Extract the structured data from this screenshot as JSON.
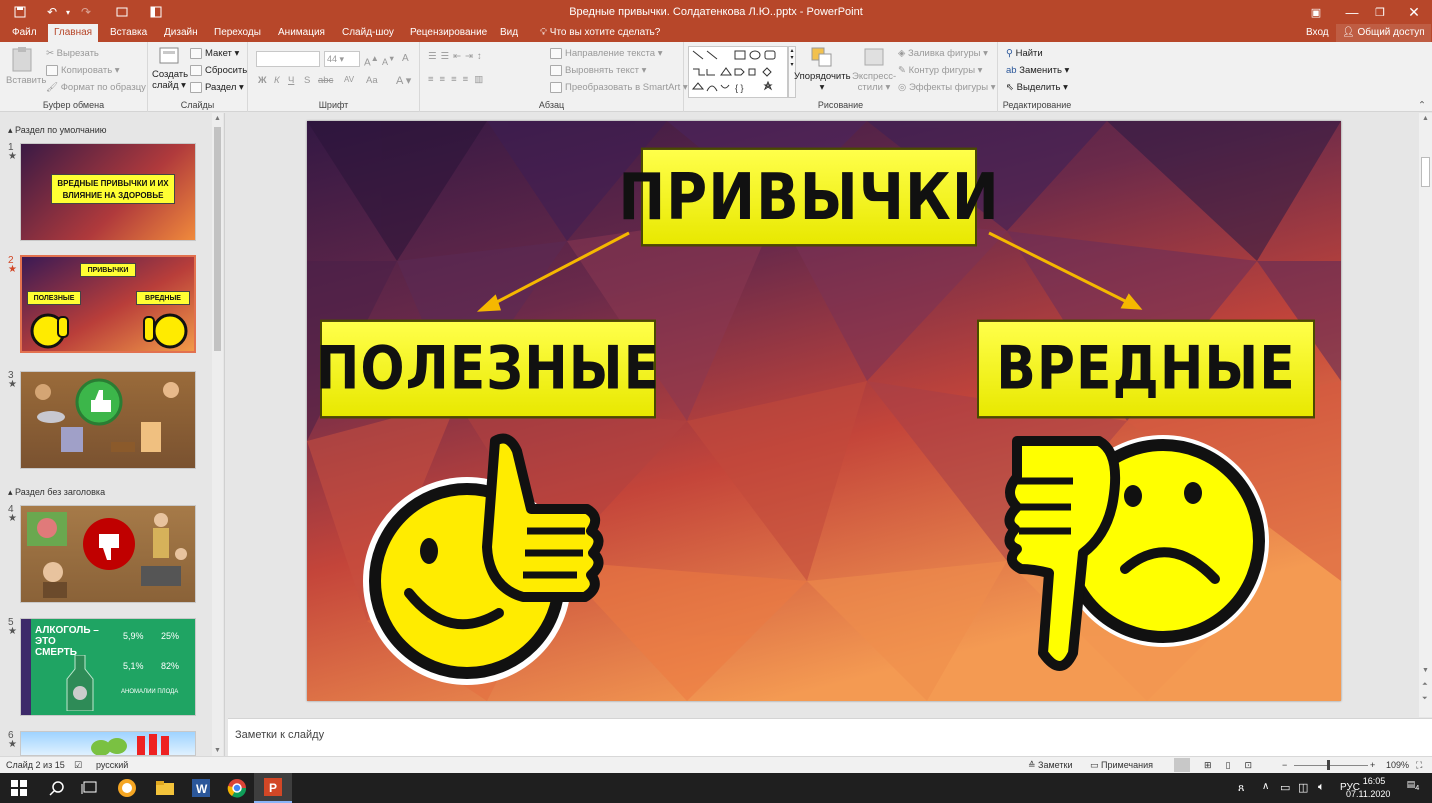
{
  "window": {
    "title": "Вредные привычки. Солдатенкова Л.Ю..pptx - PowerPoint",
    "enter_label": "Вход",
    "share_label": "Общий доступ"
  },
  "tabs": [
    {
      "label": "Файл"
    },
    {
      "label": "Главная"
    },
    {
      "label": "Вставка"
    },
    {
      "label": "Дизайн"
    },
    {
      "label": "Переходы"
    },
    {
      "label": "Анимация"
    },
    {
      "label": "Слайд-шоу"
    },
    {
      "label": "Рецензирование"
    },
    {
      "label": "Вид"
    }
  ],
  "tell_me": "Что вы хотите сделать?",
  "ribbon": {
    "clipboard": {
      "label": "Буфер обмена",
      "paste": "Вставить",
      "cut": "Вырезать",
      "copy": "Копировать",
      "format": "Формат по образцу"
    },
    "slides": {
      "label": "Слайды",
      "new_slide_1": "Создать",
      "new_slide_2": "слайд",
      "layout": "Макет",
      "reset": "Сбросить",
      "section": "Раздел"
    },
    "font": {
      "label": "Шрифт",
      "size": "44",
      "bold": "Ж",
      "italic": "К",
      "underline": "Ч",
      "shadow": "S",
      "strike": "abc",
      "spacing": "AV",
      "case": "Aa",
      "size_up": "A",
      "size_down": "A",
      "clear": "A",
      "color": "A"
    },
    "paragraph": {
      "label": "Абзац",
      "text_dir": "Направление текста",
      "align_text": "Выровнять текст",
      "smartart": "Преобразовать в SmartArt"
    },
    "drawing": {
      "label": "Рисование",
      "arrange": "Упорядочить",
      "quick_styles_1": "Экспресс-",
      "quick_styles_2": "стили",
      "fill": "Заливка фигуры",
      "outline": "Контур фигуры",
      "effects": "Эффекты фигуры"
    },
    "editing": {
      "label": "Редактирование",
      "find": "Найти",
      "replace": "Заменить",
      "select": "Выделить"
    }
  },
  "sections": {
    "default": "Раздел по умолчанию",
    "untitled": "Раздел без заголовка"
  },
  "thumbnails": [
    {
      "num": "1",
      "star": "★",
      "title": "ВРЕДНЫЕ ПРИВЫЧКИ И ИХ ВЛИЯНИЕ НА ЗДОРОВЬЕ"
    },
    {
      "num": "2",
      "star": "★",
      "top": "ПРИВЫЧКИ",
      "left": "ПОЛЕЗНЫЕ",
      "right": "ВРЕДНЫЕ"
    },
    {
      "num": "3",
      "star": "★"
    },
    {
      "num": "4",
      "star": "★"
    },
    {
      "num": "5",
      "star": "★",
      "text1": "АЛКОГОЛЬ –",
      "text2": "ЭТО",
      "text3": "СМЕРТЬ",
      "stat1": "5,9%",
      "stat2": "25%",
      "stat3": "5,1%",
      "stat4": "82%",
      "footer": "АНОМАЛИИ ПЛОДА"
    },
    {
      "num": "6",
      "star": "★"
    }
  ],
  "slide": {
    "top_box": "ПРИВЫЧКИ",
    "left_box": "ПОЛЕЗНЫЕ",
    "right_box": "ВРЕДНЫЕ"
  },
  "notes_placeholder": "Заметки к слайду",
  "status": {
    "slide_info": "Слайд 2 из 15",
    "language": "русский",
    "notes": "Заметки",
    "comments": "Примечания",
    "zoom": "109%"
  },
  "taskbar": {
    "lang": "РУС",
    "time": "16:05",
    "date": "07.11.2020",
    "notif": "4"
  },
  "colors": {
    "accent": "#b7472a",
    "slide_box": "#ffff33",
    "selected_thumb": "#e2714f"
  }
}
